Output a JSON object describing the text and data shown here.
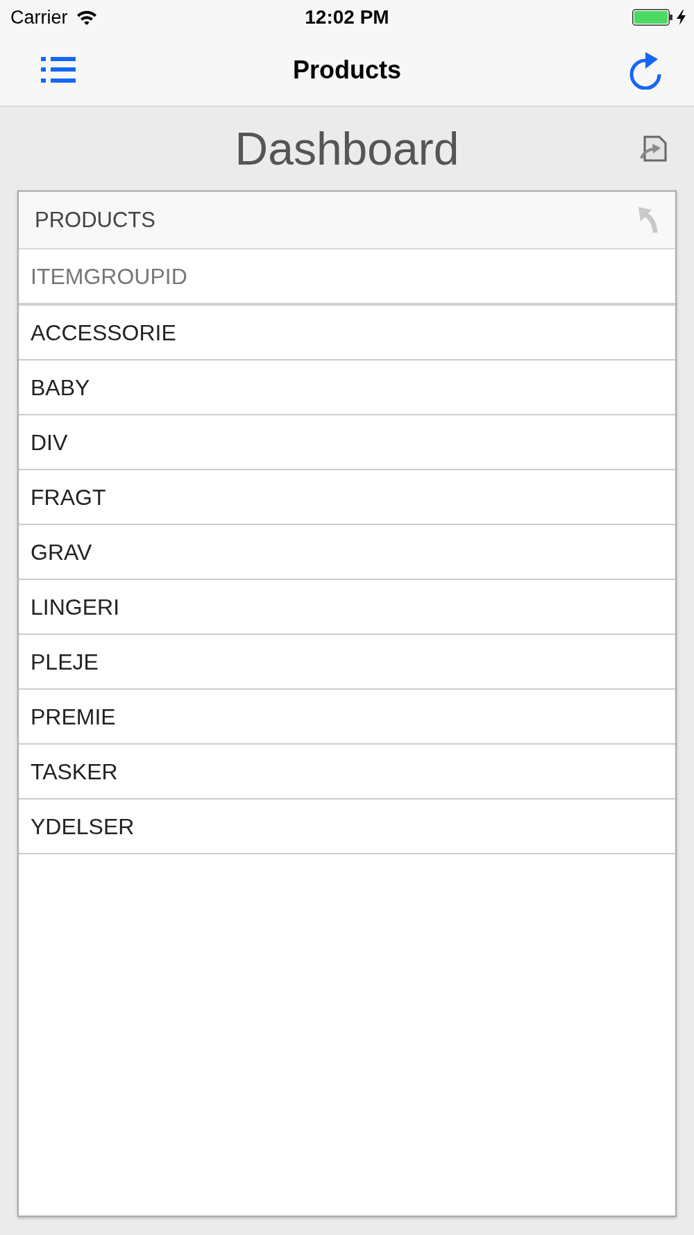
{
  "status_bar": {
    "carrier": "Carrier",
    "time": "12:02 PM"
  },
  "nav_bar": {
    "title": "Products"
  },
  "dashboard": {
    "title": "Dashboard"
  },
  "panel": {
    "title": "PRODUCTS",
    "table": {
      "columns": [
        "ITEMGROUPID"
      ],
      "rows": [
        [
          "ACCESSORIE"
        ],
        [
          "BABY"
        ],
        [
          "DIV"
        ],
        [
          "FRAGT"
        ],
        [
          "GRAV"
        ],
        [
          "LINGERI"
        ],
        [
          "PLEJE"
        ],
        [
          "PREMIE"
        ],
        [
          "TASKER"
        ],
        [
          "YDELSER"
        ]
      ]
    }
  }
}
